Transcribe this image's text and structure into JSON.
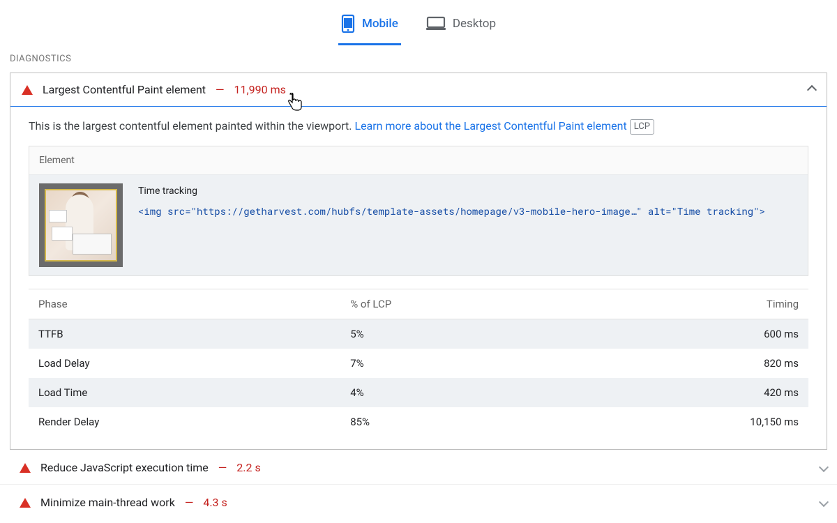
{
  "tabs": {
    "mobile": "Mobile",
    "desktop": "Desktop"
  },
  "section_label": "DIAGNOSTICS",
  "lcp_audit": {
    "title": "Largest Contentful Paint element",
    "metric": "11,990 ms",
    "description_prefix": "This is the largest contentful element painted within the viewport. ",
    "learn_more": "Learn more about the Largest Contentful Paint element",
    "badge": "LCP",
    "element_header": "Element",
    "element_label": "Time tracking",
    "element_code": "<img src=\"https://getharvest.com/hubfs/template-assets/homepage/v3-mobile-hero-image…\" alt=\"Time tracking\">",
    "table": {
      "headers": {
        "phase": "Phase",
        "percent": "% of LCP",
        "timing": "Timing"
      },
      "rows": [
        {
          "phase": "TTFB",
          "percent": "5%",
          "timing": "600 ms"
        },
        {
          "phase": "Load Delay",
          "percent": "7%",
          "timing": "820 ms"
        },
        {
          "phase": "Load Time",
          "percent": "4%",
          "timing": "420 ms"
        },
        {
          "phase": "Render Delay",
          "percent": "85%",
          "timing": "10,150 ms"
        }
      ]
    }
  },
  "collapsed_audits": [
    {
      "title": "Reduce JavaScript execution time",
      "metric": "2.2 s"
    },
    {
      "title": "Minimize main-thread work",
      "metric": "4.3 s"
    }
  ],
  "separator": "—"
}
